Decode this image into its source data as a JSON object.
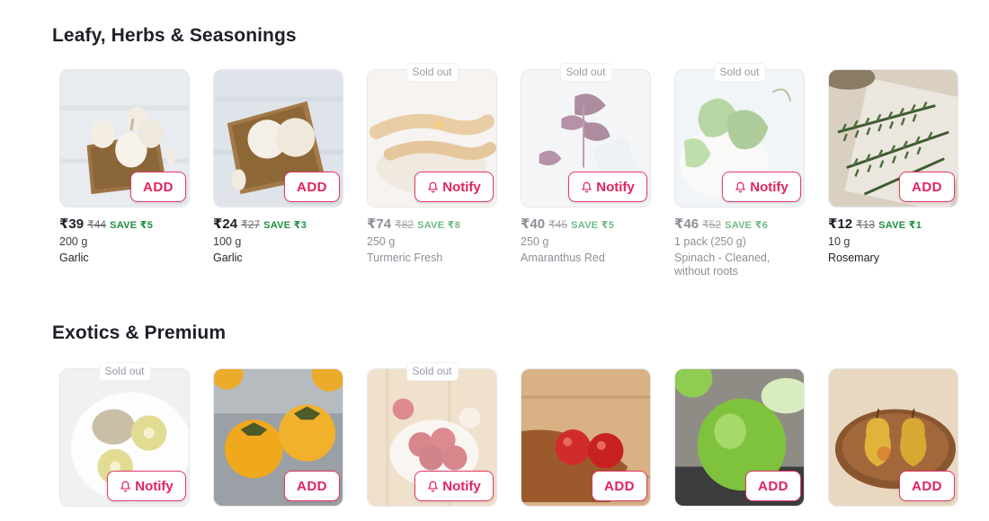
{
  "colors": {
    "accent": "#e0245e",
    "save_green": "#1c8f3c",
    "soldout_text": "#9a9aa6"
  },
  "sections": [
    {
      "title": "Leafy, Herbs & Seasonings",
      "products": [
        {
          "name": "Garlic",
          "price": "₹39",
          "mrp": "₹44",
          "save": "SAVE ₹5",
          "qty": "200 g",
          "sold_out": false,
          "action": "ADD",
          "image": "garlic-image"
        },
        {
          "name": "Garlic",
          "price": "₹24",
          "mrp": "₹27",
          "save": "SAVE ₹3",
          "qty": "100 g",
          "sold_out": false,
          "action": "ADD",
          "image": "garlic-image"
        },
        {
          "name": "Turmeric Fresh",
          "price": "₹74",
          "mrp": "₹82",
          "save": "SAVE ₹8",
          "qty": "250 g",
          "sold_out": true,
          "soldout_label": "Sold out",
          "action": "Notify",
          "image": "turmeric-image"
        },
        {
          "name": "Amaranthus Red",
          "price": "₹40",
          "mrp": "₹45",
          "save": "SAVE ₹5",
          "qty": "250 g",
          "sold_out": true,
          "soldout_label": "Sold out",
          "action": "Notify",
          "image": "amaranthus-image"
        },
        {
          "name": "Spinach - Cleaned, without roots",
          "price": "₹46",
          "mrp": "₹52",
          "save": "SAVE ₹6",
          "qty": "1 pack (250 g)",
          "sold_out": true,
          "soldout_label": "Sold out",
          "action": "Notify",
          "image": "spinach-image"
        },
        {
          "name": "Rosemary",
          "price": "₹12",
          "mrp": "₹13",
          "save": "SAVE ₹1",
          "qty": "10 g",
          "sold_out": false,
          "action": "ADD",
          "image": "rosemary-image"
        }
      ]
    },
    {
      "title": "Exotics & Premium",
      "products": [
        {
          "sold_out": true,
          "soldout_label": "Sold out",
          "action": "Notify",
          "image": "kiwi-image"
        },
        {
          "sold_out": false,
          "action": "ADD",
          "image": "persimmon-image"
        },
        {
          "sold_out": true,
          "soldout_label": "Sold out",
          "action": "Notify",
          "image": "apple-bowl-image"
        },
        {
          "sold_out": false,
          "action": "ADD",
          "image": "apple-board-image"
        },
        {
          "sold_out": false,
          "action": "ADD",
          "image": "guava-image"
        },
        {
          "sold_out": false,
          "action": "ADD",
          "image": "pear-image"
        }
      ]
    }
  ]
}
